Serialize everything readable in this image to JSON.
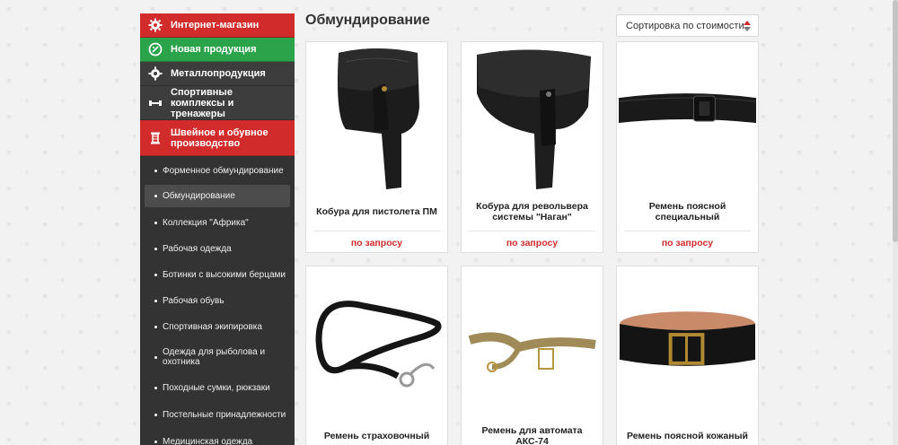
{
  "sidebar": {
    "categories": [
      {
        "label": "Интернет-магазин",
        "icon": "gear-icon"
      },
      {
        "label": "Новая продукция",
        "icon": "tag-icon"
      },
      {
        "label": "Металлопродукция",
        "icon": "gear-icon"
      },
      {
        "label": "Спортивные комплексы и тренажеры",
        "icon": "dumbbell-icon"
      },
      {
        "label": "Швейное и обувное производство",
        "icon": "spool-icon"
      }
    ],
    "subitems": [
      "Форменное обмундирование",
      "Обмундирование",
      "Коллекция \"Африка\"",
      "Рабочая одежда",
      "Ботинки с высокими берцами",
      "Рабочая обувь",
      "Спортивная экипировка",
      "Одежда для рыболова и охотника",
      "Походные сумки, рюкзаки",
      "Постельные принадлежности",
      "Медицинская одежда"
    ],
    "active_index": 1
  },
  "main": {
    "title": "Обмундирование",
    "sort_label": "Сортировка по стоимости:"
  },
  "products": [
    {
      "name": "Кобура для пистолета ПМ",
      "price": "по запросу"
    },
    {
      "name": "Кобура для револьвера системы \"Наган\"",
      "price": "по запросу"
    },
    {
      "name": "Ремень поясной специальный",
      "price": "по запросу"
    },
    {
      "name": "Ремень страховочный",
      "price": ""
    },
    {
      "name": "Ремень для автомата АКС-74",
      "price": ""
    },
    {
      "name": "Ремень поясной кожаный",
      "price": ""
    }
  ],
  "colors": {
    "accent_red": "#d12b2b",
    "accent_green": "#2aa34a",
    "sidebar_bg": "#333333"
  }
}
